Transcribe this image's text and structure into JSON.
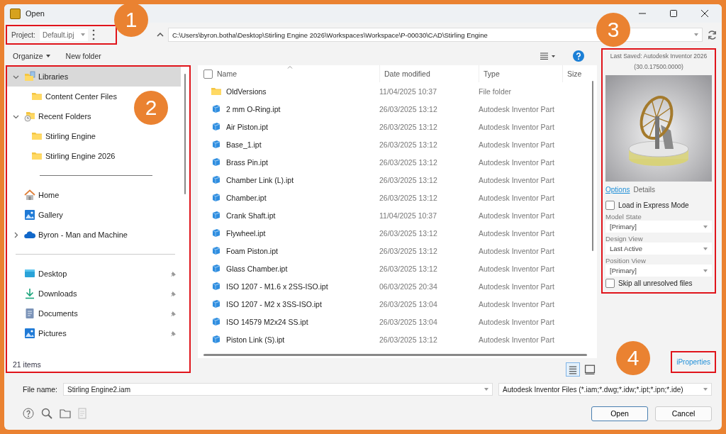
{
  "window": {
    "title": "Open"
  },
  "project": {
    "label": "Project:",
    "value": "Default.ipj",
    "highlighted": true
  },
  "path": "C:\\Users\\byron.botha\\Desktop\\Stirling Engine 2026\\Workspaces\\Workspace\\P-00030\\CAD\\Stirling Engine",
  "toolbar": {
    "organize": "Organize",
    "new_folder": "New folder"
  },
  "sidebar": {
    "highlighted": true,
    "status": "21 items",
    "items": [
      {
        "kind": "library",
        "label": "Libraries",
        "selected": true,
        "expanded": true,
        "children": [
          {
            "kind": "folder",
            "label": "Content Center Files",
            "selected": false
          }
        ]
      },
      {
        "kind": "recent",
        "label": "Recent Folders",
        "selected": false,
        "expanded": true,
        "children": [
          {
            "kind": "folder",
            "label": "Stirling Engine",
            "selected": false
          },
          {
            "kind": "folder",
            "label": "Stirling Engine 2026",
            "selected": false
          }
        ]
      },
      {
        "kind": "separator"
      },
      {
        "kind": "home",
        "label": "Home",
        "selected": false
      },
      {
        "kind": "gallery",
        "label": "Gallery",
        "selected": false
      },
      {
        "kind": "cloud",
        "label": "Byron - Man and Machine",
        "selected": false,
        "expanded": false
      },
      {
        "kind": "separator"
      },
      {
        "kind": "desktop",
        "label": "Desktop",
        "selected": false,
        "pinned": true
      },
      {
        "kind": "downloads",
        "label": "Downloads",
        "selected": false,
        "pinned": true
      },
      {
        "kind": "documents",
        "label": "Documents",
        "selected": false,
        "pinned": true
      },
      {
        "kind": "pictures",
        "label": "Pictures",
        "selected": false,
        "pinned": true
      }
    ]
  },
  "file_list": {
    "select_all_checked": false,
    "columns": [
      "Name",
      "Date modified",
      "Type",
      "Size"
    ],
    "rows": [
      {
        "kind": "folder",
        "name": "OldVersions",
        "date": "11/04/2025 10:37",
        "type": "File folder"
      },
      {
        "kind": "part",
        "name": "2 mm O-Ring.ipt",
        "date": "26/03/2025 13:12",
        "type": "Autodesk Inventor Part"
      },
      {
        "kind": "part",
        "name": "Air Piston.ipt",
        "date": "26/03/2025 13:12",
        "type": "Autodesk Inventor Part"
      },
      {
        "kind": "part",
        "name": "Base_1.ipt",
        "date": "26/03/2025 13:12",
        "type": "Autodesk Inventor Part"
      },
      {
        "kind": "part",
        "name": "Brass Pin.ipt",
        "date": "26/03/2025 13:12",
        "type": "Autodesk Inventor Part"
      },
      {
        "kind": "part",
        "name": "Chamber Link (L).ipt",
        "date": "26/03/2025 13:12",
        "type": "Autodesk Inventor Part"
      },
      {
        "kind": "part",
        "name": "Chamber.ipt",
        "date": "26/03/2025 13:12",
        "type": "Autodesk Inventor Part"
      },
      {
        "kind": "part",
        "name": "Crank Shaft.ipt",
        "date": "11/04/2025 10:37",
        "type": "Autodesk Inventor Part"
      },
      {
        "kind": "part",
        "name": "Flywheel.ipt",
        "date": "26/03/2025 13:12",
        "type": "Autodesk Inventor Part"
      },
      {
        "kind": "part",
        "name": "Foam Piston.ipt",
        "date": "26/03/2025 13:12",
        "type": "Autodesk Inventor Part"
      },
      {
        "kind": "part",
        "name": "Glass Chamber.ipt",
        "date": "26/03/2025 13:12",
        "type": "Autodesk Inventor Part"
      },
      {
        "kind": "part",
        "name": "ISO 1207 - M1.6 x 2SS-ISO.ipt",
        "date": "06/03/2025 20:34",
        "type": "Autodesk Inventor Part"
      },
      {
        "kind": "part",
        "name": "ISO 1207 - M2 x 3SS-ISO.ipt",
        "date": "26/03/2025 13:04",
        "type": "Autodesk Inventor Part"
      },
      {
        "kind": "part",
        "name": "ISO 14579 M2x24 SS.ipt",
        "date": "26/03/2025 13:04",
        "type": "Autodesk Inventor Part"
      },
      {
        "kind": "part",
        "name": "Piston Link (S).ipt",
        "date": "26/03/2025 13:12",
        "type": "Autodesk Inventor Part"
      }
    ]
  },
  "view_modes": [
    {
      "kind": "details",
      "selected": true
    },
    {
      "kind": "preview",
      "selected": false
    }
  ],
  "preview": {
    "highlighted": true,
    "caption": [
      "Last Saved: Autodesk Inventor 2026",
      "(30.0.17500.0000)"
    ],
    "tabs": [
      {
        "label": "Options",
        "selected": true
      },
      {
        "label": "Details",
        "selected": false
      }
    ],
    "options": [
      {
        "kind": "checkbox",
        "label": "Load in Express Mode",
        "checked": false
      },
      {
        "kind": "dropdown",
        "label": "Model State",
        "value": "[Primary]"
      },
      {
        "kind": "dropdown",
        "label": "Design View",
        "value": "Last Active"
      },
      {
        "kind": "dropdown",
        "label": "Position View",
        "value": "[Primary]"
      },
      {
        "kind": "checkbox",
        "label": "Skip all unresolved files",
        "checked": false
      }
    ]
  },
  "iproperties": {
    "label": "iProperties",
    "highlighted": true
  },
  "file_name": {
    "label": "File name:",
    "value": "Stirling Engine2.iam"
  },
  "file_type": "Autodesk Inventor Files (*.iam;*.dwg;*.idw;*.ipt;*.ipn;*.ide)",
  "buttons": [
    {
      "label": "Open",
      "default": true
    },
    {
      "label": "Cancel",
      "default": false
    }
  ],
  "callouts": [
    "1",
    "2",
    "3",
    "4"
  ]
}
